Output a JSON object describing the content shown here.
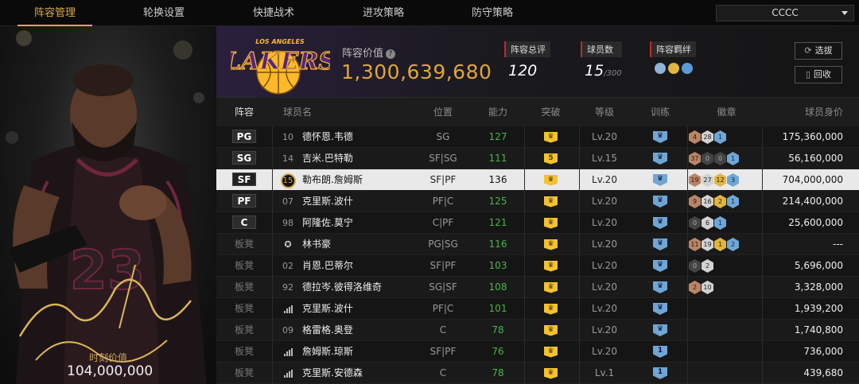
{
  "nav": {
    "tabs": [
      "阵容管理",
      "轮换设置",
      "快捷战术",
      "进攻策略",
      "防守策略"
    ],
    "active_index": 0,
    "team_select": "CCCC"
  },
  "player_card": {
    "value_label": "时刻价值",
    "value": "104,000,000",
    "jersey_number": "23"
  },
  "header": {
    "lineup_value_label": "阵容价值",
    "lineup_value": "1,300,639,680",
    "team_logo_text": "LAKERS",
    "team_logo_city": "LOS ANGELES",
    "total_rating_label": "阵容总评",
    "total_rating": "120",
    "player_count_label": "球员数",
    "player_count": "15",
    "player_count_max": "/300",
    "bond_label": "阵容羁绊",
    "btn_select": "选拔",
    "btn_recycle": "回收"
  },
  "table": {
    "columns": {
      "lineup": "阵容",
      "name": "球员名",
      "role": "位置",
      "ovr": "能力",
      "breakthrough": "突破",
      "level": "等级",
      "training": "训练",
      "badges": "徽章",
      "value": "球员身价"
    },
    "rows": [
      {
        "slot": "PG",
        "starter": true,
        "num": "10",
        "name": "德怀恩.韦德",
        "role": "SG",
        "ovr": "127",
        "brk": "",
        "lv": "Lv.20",
        "train": "",
        "badges": [
          [
            "bronze",
            "4"
          ],
          [
            "silver",
            "28"
          ],
          [
            "blue",
            "1"
          ]
        ],
        "value": "175,360,000"
      },
      {
        "slot": "SG",
        "starter": true,
        "num": "14",
        "name": "吉米.巴特勒",
        "role": "SF|SG",
        "ovr": "111",
        "brk": "5",
        "lv": "Lv.15",
        "train": "",
        "badges": [
          [
            "bronze",
            "37"
          ],
          [
            "dark",
            "0"
          ],
          [
            "dark",
            "0"
          ],
          [
            "blue",
            "1"
          ]
        ],
        "value": "56,160,000"
      },
      {
        "slot": "SF",
        "starter": true,
        "selected": true,
        "num": "15",
        "name": "勒布朗.詹姆斯",
        "role": "SF|PF",
        "ovr": "136",
        "brk": "",
        "lv": "Lv.20",
        "train": "",
        "badges": [
          [
            "bronze",
            "19"
          ],
          [
            "silver",
            "27"
          ],
          [
            "gold",
            "12"
          ],
          [
            "blue",
            "3"
          ]
        ],
        "value": "704,000,000"
      },
      {
        "slot": "PF",
        "starter": true,
        "num": "07",
        "name": "克里斯.波什",
        "role": "PF|C",
        "ovr": "125",
        "brk": "",
        "lv": "Lv.20",
        "train": "",
        "badges": [
          [
            "bronze",
            "9"
          ],
          [
            "silver",
            "16"
          ],
          [
            "gold",
            "2"
          ],
          [
            "blue",
            "1"
          ]
        ],
        "value": "214,400,000"
      },
      {
        "slot": "C",
        "starter": true,
        "num": "98",
        "name": "阿隆佐.莫宁",
        "role": "C|PF",
        "ovr": "121",
        "brk": "",
        "lv": "Lv.20",
        "train": "",
        "badges": [
          [
            "dark",
            "0"
          ],
          [
            "silver",
            "6"
          ],
          [
            "blue",
            "1"
          ]
        ],
        "value": "25,600,000"
      },
      {
        "slot": "板凳",
        "starter": false,
        "num": "",
        "star": true,
        "name": "林书豪",
        "role": "PG|SG",
        "ovr": "116",
        "brk": "",
        "lv": "Lv.20",
        "train": "",
        "badges": [
          [
            "bronze",
            "11"
          ],
          [
            "silver",
            "19"
          ],
          [
            "gold",
            "1"
          ],
          [
            "blue",
            "2"
          ]
        ],
        "value": "---"
      },
      {
        "slot": "板凳",
        "starter": false,
        "num": "02",
        "name": "肖恩.巴蒂尔",
        "role": "SF|PF",
        "ovr": "103",
        "brk": "",
        "lv": "Lv.20",
        "train": "",
        "badges": [
          [
            "dark",
            "0"
          ],
          [
            "silver",
            "2"
          ]
        ],
        "value": "5,696,000"
      },
      {
        "slot": "板凳",
        "starter": false,
        "num": "92",
        "name": "德拉岑.彼得洛维奇",
        "role": "SG|SF",
        "ovr": "108",
        "brk": "",
        "lv": "Lv.20",
        "train": "",
        "badges": [
          [
            "bronze",
            "2"
          ],
          [
            "silver",
            "10"
          ]
        ],
        "value": "3,328,000"
      },
      {
        "slot": "板凳",
        "starter": false,
        "num": "",
        "bars": true,
        "name": "克里斯.波什",
        "role": "PF|C",
        "ovr": "101",
        "brk": "",
        "lv": "Lv.20",
        "train": "",
        "badges": [],
        "value": "1,939,200"
      },
      {
        "slot": "板凳",
        "starter": false,
        "num": "09",
        "name": "格雷格.奥登",
        "role": "C",
        "ovr": "78",
        "brk": "",
        "lv": "Lv.20",
        "train": "",
        "badges": [],
        "value": "1,740,800"
      },
      {
        "slot": "板凳",
        "starter": false,
        "num": "",
        "bars": true,
        "name": "詹姆斯.琼斯",
        "role": "SF|PF",
        "ovr": "76",
        "brk": "",
        "lv": "Lv.20",
        "train": "1",
        "badges": [],
        "value": "736,000"
      },
      {
        "slot": "板凳",
        "starter": false,
        "num": "",
        "bars": true,
        "name": "克里斯.安德森",
        "role": "C",
        "ovr": "78",
        "brk": "",
        "lv": "Lv.1",
        "train": "1",
        "badges": [],
        "value": "439,680"
      }
    ]
  },
  "colors": {
    "gold_accent": "#d9a94a",
    "ovr_green": "#49b44a",
    "lakers_purple": "#552583",
    "lakers_gold": "#fdb927",
    "cavs_wine": "#6f263d"
  }
}
